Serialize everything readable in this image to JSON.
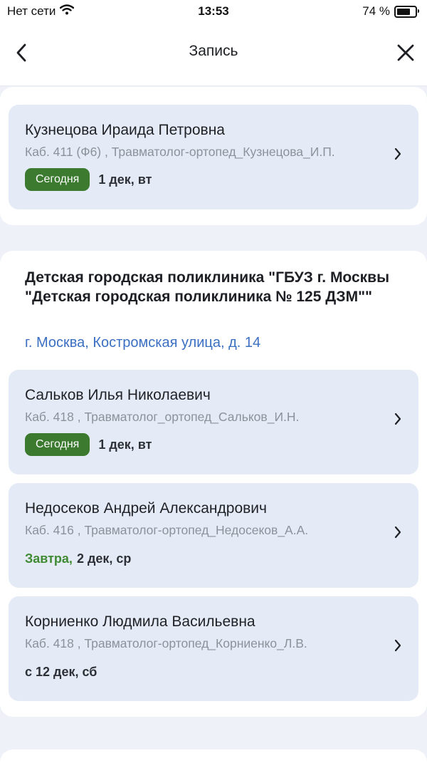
{
  "status": {
    "carrier": "Нет сети",
    "time": "13:53",
    "battery_percent": "74 %",
    "battery_level": 0.74
  },
  "nav": {
    "title": "Запись"
  },
  "first_card": {
    "doctor": "Кузнецова Ираида Петровна",
    "details": "Каб. 411 (Ф6) , Травматолог-ортопед_Кузнецова_И.П.",
    "badge": "Сегодня",
    "date": "1 дек, вт"
  },
  "clinic": {
    "name": "Детская городская поликлиника \"ГБУЗ г. Москвы \"Детская городская поликлиника № 125 ДЗМ\"\"",
    "address": "г. Москва, Костромская улица, д. 14"
  },
  "cards": [
    {
      "doctor": "Сальков Илья Николаевич",
      "details": "Каб. 418 , Травматолог_ортопед_Сальков_И.Н.",
      "badge": "Сегодня",
      "date": "1 дек, вт"
    },
    {
      "doctor": "Недосеков Андрей Александрович",
      "details": "Каб. 416 , Травматолог-ортопед_Недосеков_А.А.",
      "highlight": "Завтра,",
      "date": "2 дек, ср"
    },
    {
      "doctor": "Корниенко Людмила Васильевна",
      "details": "Каб. 418 , Травматолог-ортопед_Корниенко_Л.В.",
      "date": "с 12 дек, сб"
    }
  ]
}
